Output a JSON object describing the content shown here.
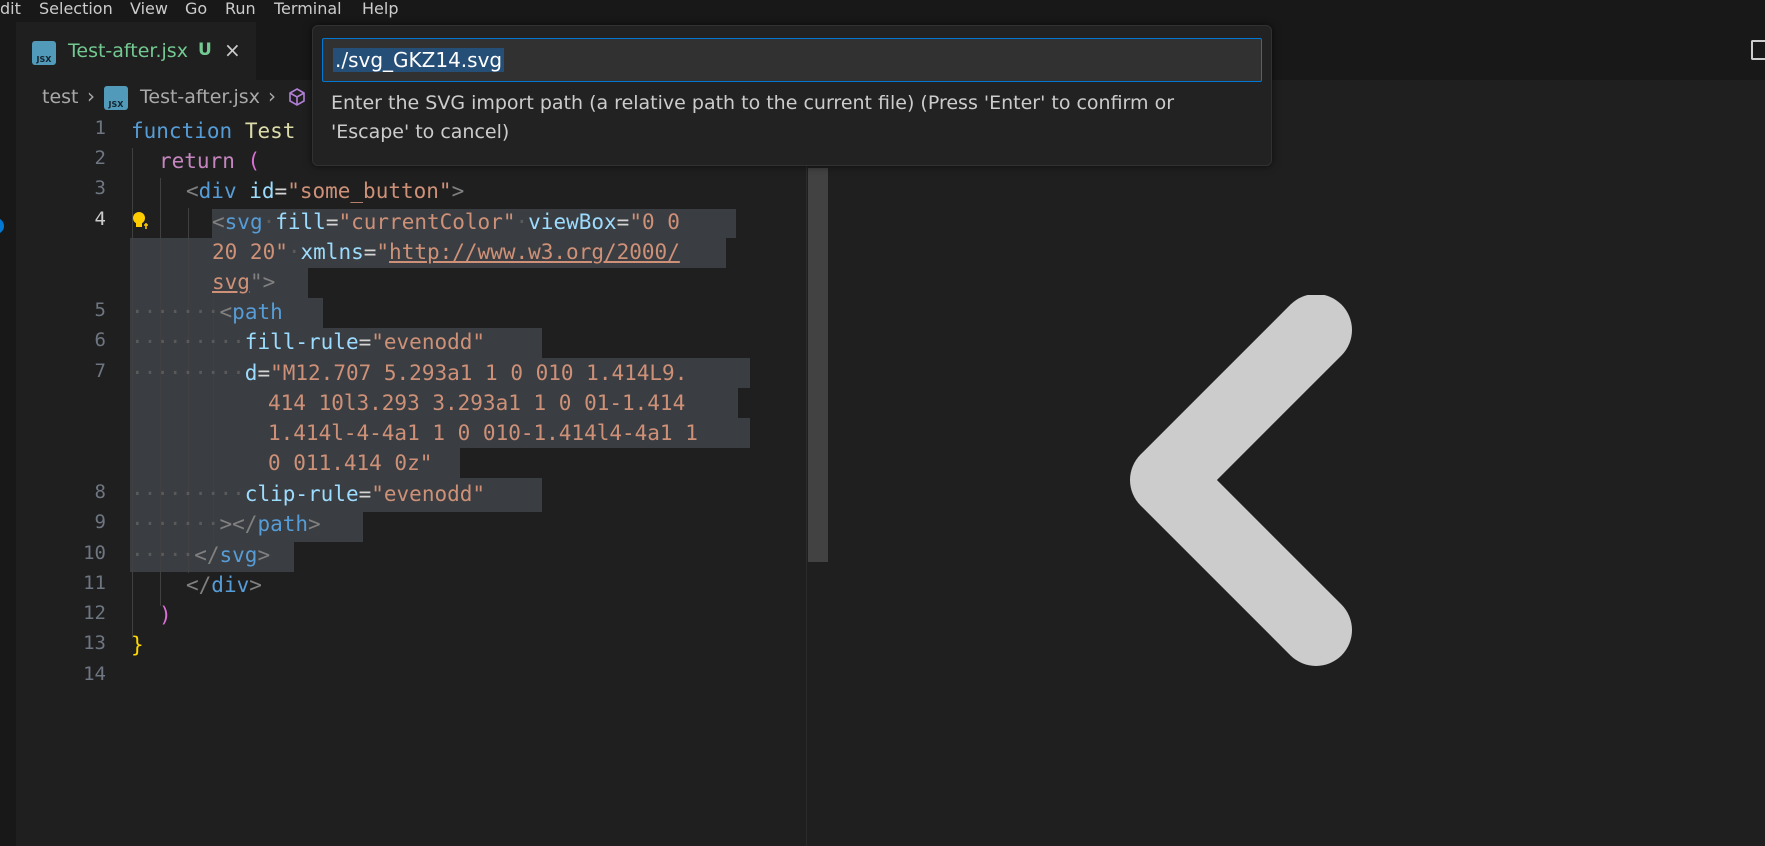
{
  "menubar": {
    "items": [
      "dit",
      "Selection",
      "View",
      "Go",
      "Run",
      "Terminal",
      "Help"
    ]
  },
  "tab": {
    "icon": "jsx-file-icon",
    "icon_text": "JSX",
    "label": "Test-after.jsx",
    "status": "U",
    "close": "×"
  },
  "breadcrumb": {
    "folder": "test",
    "file": "Test-after.jsx",
    "file_icon_text": "JSX",
    "symbol_icon": "symbol-method-icon"
  },
  "quick_input": {
    "value": "./svg_GKZ14.svg",
    "description": "Enter the SVG import path (a relative path to the current file) (Press 'Enter' to confirm or 'Escape' to cancel)"
  },
  "editor": {
    "active_line": 4,
    "line_numbers": [
      "1",
      "2",
      "3",
      "4",
      "5",
      "6",
      "7",
      "8",
      "9",
      "10",
      "11",
      "12",
      "13",
      "14"
    ],
    "code": {
      "l1_kw": "function",
      "l1_name": "Test",
      "l2_kw": "return",
      "l2_paren": "(",
      "l3_open": "<",
      "l3_tag": "div",
      "l3_attr": "id",
      "l3_eq": "=",
      "l3_val": "\"some_button\"",
      "l3_close": ">",
      "l4_open": "<",
      "l4_tag": "svg",
      "l4_attr1": "fill",
      "l4_val1": "\"currentColor\"",
      "l4_attr2": "viewBox",
      "l4_val2a": "\"0 0",
      "l4b_val2b": "20 20\"",
      "l4b_attr3": "xmlns",
      "l4b_q": "\"",
      "l4b_url": "http://www.w3.org/2000/",
      "l4c_url": "svg",
      "l4c_end": "\">",
      "l5_tag": "path",
      "l6_attr": "fill-rule",
      "l6_val": "\"evenodd\"",
      "l7_attr": "d",
      "l7_val1": "\"M12.707 5.293a1 1 0 010 1.414L9.",
      "l7_val2": "414 10l3.293 3.293a1 1 0 01-1.414",
      "l7_val3": "1.414l-4-4a1 1 0 010-1.414l4-4a1 1",
      "l7_val4": "0 011.414 0z\"",
      "l8_attr": "clip-rule",
      "l8_val": "\"evenodd\"",
      "l9_close": "></",
      "l9_tag": "path",
      "l9_end": ">",
      "l10_close": "</",
      "l10_tag": "svg",
      "l10_end": ">",
      "l11_close": "</",
      "l11_tag": "div",
      "l11_end": ">",
      "l12_paren": ")",
      "l13_brace": "}"
    }
  },
  "colors": {
    "accent": "#0078d4",
    "untracked": "#73c991",
    "selection": "#264f78"
  }
}
